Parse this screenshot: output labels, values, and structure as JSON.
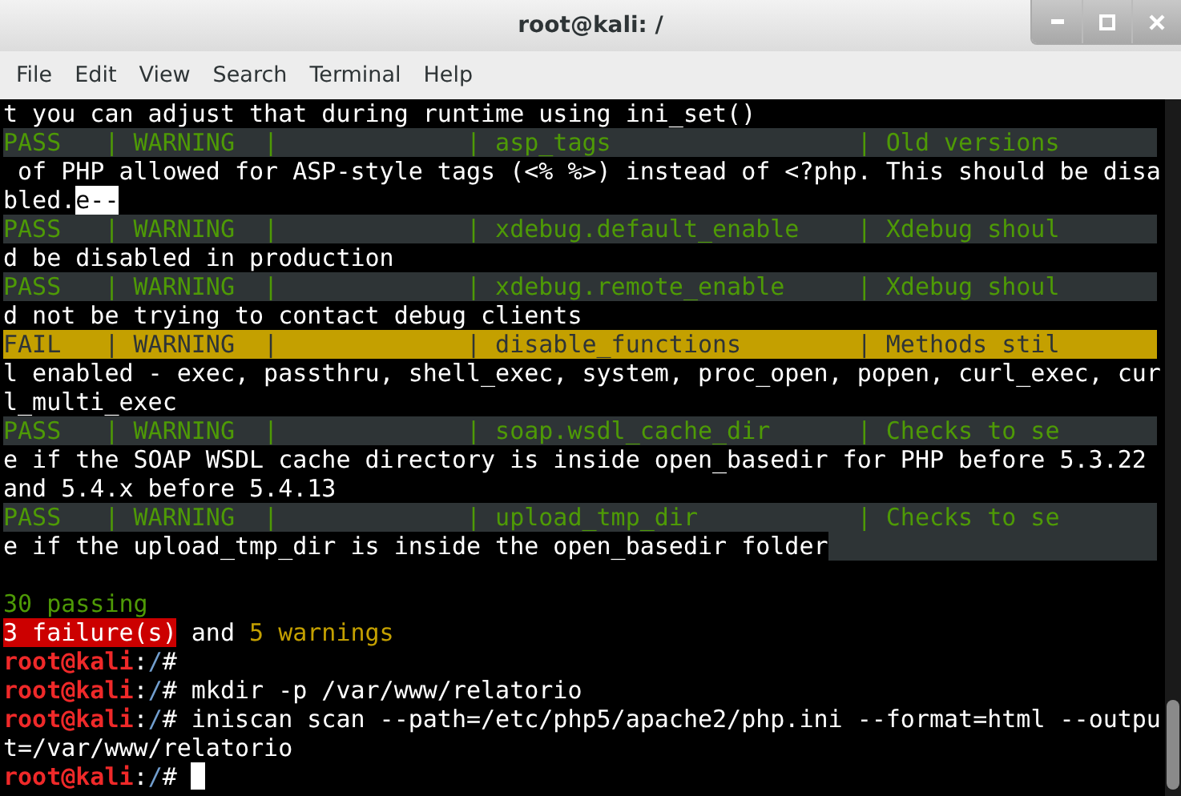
{
  "window": {
    "title": "root@kali: /"
  },
  "menu": [
    "File",
    "Edit",
    "View",
    "Search",
    "Terminal",
    "Help"
  ],
  "lines": [
    {
      "kind": "text",
      "segments": [
        {
          "text": "t you can adjust that during runtime using ini_set()",
          "kind": "plain"
        }
      ]
    },
    {
      "kind": "pass",
      "segments": [
        {
          "text": "PASS   | WARNING  |             | asp_tags                 | Old versions",
          "kind": "green"
        }
      ]
    },
    {
      "kind": "text",
      "segments": [
        {
          "text": " of PHP allowed for ASP-style tags (<% %>) instead of <?php. This should be disa",
          "kind": "plain"
        }
      ]
    },
    {
      "kind": "text",
      "segments": [
        {
          "text": "bled.",
          "kind": "plain"
        },
        {
          "text": "e--",
          "kind": "inverse"
        }
      ]
    },
    {
      "kind": "pass",
      "segments": [
        {
          "text": "PASS   | WARNING  |             | xdebug.default_enable    | Xdebug shoul",
          "kind": "green"
        }
      ]
    },
    {
      "kind": "text",
      "segments": [
        {
          "text": "d be disabled in production",
          "kind": "plain"
        }
      ]
    },
    {
      "kind": "pass",
      "segments": [
        {
          "text": "PASS   | WARNING  |             | xdebug.remote_enable     | Xdebug shoul",
          "kind": "green"
        }
      ]
    },
    {
      "kind": "text",
      "segments": [
        {
          "text": "d not be trying to contact debug clients",
          "kind": "plain"
        }
      ]
    },
    {
      "kind": "fail",
      "segments": [
        {
          "text": "FAIL   | WARNING  |             | disable_functions        | Methods stil",
          "kind": "dark"
        }
      ]
    },
    {
      "kind": "text",
      "segments": [
        {
          "text": "l enabled - exec, passthru, shell_exec, system, proc_open, popen, curl_exec, cur",
          "kind": "plain"
        }
      ]
    },
    {
      "kind": "text",
      "segments": [
        {
          "text": "l_multi_exec",
          "kind": "plain"
        }
      ]
    },
    {
      "kind": "pass",
      "segments": [
        {
          "text": "PASS   | WARNING  |             | soap.wsdl_cache_dir      | Checks to se",
          "kind": "green"
        }
      ]
    },
    {
      "kind": "text",
      "segments": [
        {
          "text": "e if the SOAP WSDL cache directory is inside open_basedir for PHP before 5.3.22",
          "kind": "plain"
        }
      ]
    },
    {
      "kind": "text",
      "segments": [
        {
          "text": "and 5.4.x before 5.4.13",
          "kind": "plain"
        }
      ]
    },
    {
      "kind": "pass",
      "segments": [
        {
          "text": "PASS   | WARNING  |             | upload_tmp_dir           | Checks to se",
          "kind": "green"
        }
      ]
    },
    {
      "kind": "text",
      "highlight_rest": true,
      "segments": [
        {
          "text": "e if the upload_tmp_dir is inside the open_basedir folder",
          "kind": "plain"
        }
      ]
    },
    {
      "kind": "blank"
    },
    {
      "kind": "text",
      "segments": [
        {
          "text": "30 passing",
          "kind": "green"
        }
      ]
    },
    {
      "kind": "text",
      "segments": [
        {
          "text": "3 failure(s)",
          "kind": "alert"
        },
        {
          "text": " and ",
          "kind": "plain"
        },
        {
          "text": "5 warnings",
          "kind": "yellow"
        }
      ]
    },
    {
      "kind": "text",
      "segments": [
        {
          "text": "root@kali",
          "kind": "user"
        },
        {
          "text": ":",
          "kind": "plain"
        },
        {
          "text": "/",
          "kind": "path"
        },
        {
          "text": "#",
          "kind": "plain"
        }
      ]
    },
    {
      "kind": "text",
      "segments": [
        {
          "text": "root@kali",
          "kind": "user"
        },
        {
          "text": ":",
          "kind": "plain"
        },
        {
          "text": "/",
          "kind": "path"
        },
        {
          "text": "# mkdir -p /var/www/relatorio",
          "kind": "plain"
        }
      ]
    },
    {
      "kind": "text",
      "segments": [
        {
          "text": "root@kali",
          "kind": "user"
        },
        {
          "text": ":",
          "kind": "plain"
        },
        {
          "text": "/",
          "kind": "path"
        },
        {
          "text": "# iniscan scan --path=/etc/php5/apache2/php.ini --format=html --outpu",
          "kind": "plain"
        }
      ]
    },
    {
      "kind": "text",
      "segments": [
        {
          "text": "t=/var/www/relatorio",
          "kind": "plain"
        }
      ]
    },
    {
      "kind": "text",
      "cursor": true,
      "segments": [
        {
          "text": "root@kali",
          "kind": "user"
        },
        {
          "text": ":",
          "kind": "plain"
        },
        {
          "text": "/",
          "kind": "path"
        },
        {
          "text": "# ",
          "kind": "plain"
        }
      ]
    }
  ]
}
